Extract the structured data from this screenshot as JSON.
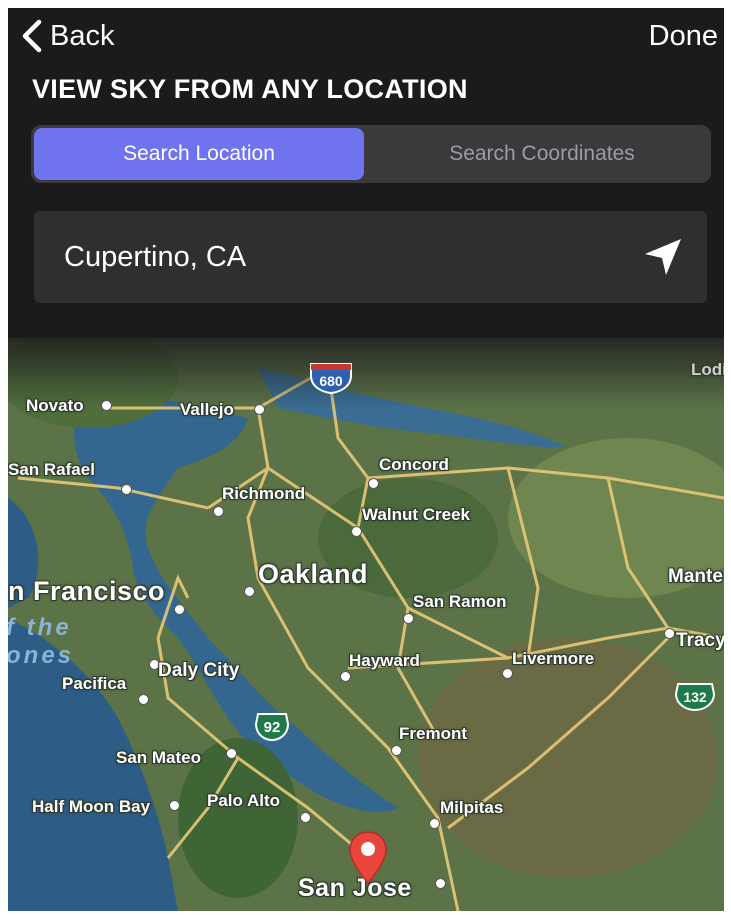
{
  "nav": {
    "back_label": "Back",
    "done_label": "Done"
  },
  "title": "VIEW SKY FROM ANY LOCATION",
  "segments": [
    {
      "label": "Search Location",
      "active": true
    },
    {
      "label": "Search Coordinates",
      "active": false
    }
  ],
  "search": {
    "value": "Cupertino, CA",
    "icon": "location-arrow-icon"
  },
  "colors": {
    "accent": "#6f73ee",
    "header_bg": "#1b1b1c",
    "pin": "#e8453c",
    "water": "#2d5c86"
  },
  "map": {
    "places": {
      "novato": "Novato",
      "vallejo": "Vallejo",
      "lodi": "Lodi",
      "san_rafael": "San Rafael",
      "concord": "Concord",
      "richmond": "Richmond",
      "walnut_creek": "Walnut Creek",
      "san_francisco": "n Francisco",
      "oakland": "Oakland",
      "manteca": "Mante",
      "san_ramon": "San Ramon",
      "tracy": "Tracy",
      "water_line1": "f  the",
      "water_line2": "ones",
      "daly_city": "Daly City",
      "hayward": "Hayward",
      "livermore": "Livermore",
      "pacifica": "Pacifica",
      "fremont": "Fremont",
      "san_mateo": "San Mateo",
      "half_moon_bay": "Half Moon Bay",
      "palo_alto": "Palo Alto",
      "milpitas": "Milpitas",
      "san_jose": "San Jose"
    },
    "highways": {
      "i680": "680",
      "ca92": "92",
      "ca132": "132"
    },
    "pin_icon": "map-pin-icon"
  }
}
